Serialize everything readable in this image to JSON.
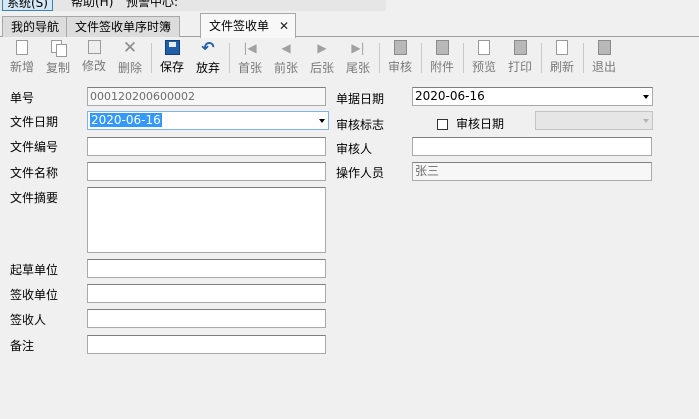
{
  "menu": {
    "system": "系统(S)",
    "help": "帮助(H)",
    "warning_center": "预警中心:"
  },
  "tabs": [
    {
      "label": "我的导航"
    },
    {
      "label": "文件签收单序时簿"
    },
    {
      "label": "文件签收单",
      "close": "✕"
    }
  ],
  "toolbar": {
    "new": "新增",
    "copy": "复制",
    "edit": "修改",
    "delete": "删除",
    "save": "保存",
    "undo": "放弃",
    "first": "首张",
    "prev": "前张",
    "next": "后张",
    "last": "尾张",
    "audit": "审核",
    "attach": "附件",
    "preview": "预览",
    "print": "打印",
    "refresh": "刷新",
    "exit": "退出"
  },
  "form": {
    "doc_no_label": "单号",
    "doc_no_value": "000120200600002",
    "file_date_label": "文件日期",
    "file_date_value": "2020-06-16",
    "file_no_label": "文件编号",
    "file_no_value": "",
    "file_name_label": "文件名称",
    "file_name_value": "",
    "summary_label": "文件摘要",
    "summary_value": "",
    "draft_unit_label": "起草单位",
    "draft_unit_value": "",
    "recv_unit_label": "签收单位",
    "recv_unit_value": "",
    "receiver_label": "签收人",
    "receiver_value": "",
    "remark_label": "备注",
    "remark_value": "",
    "bill_date_label": "单据日期",
    "bill_date_value": "2020-06-16",
    "audit_flag_label": "审核标志",
    "audit_date_label": "审核日期",
    "auditor_label": "审核人",
    "auditor_value": "",
    "operator_label": "操作人员",
    "operator_value": "张三"
  },
  "colors": {
    "accent": "#3399ff",
    "save_icon": "#1f5fa8"
  }
}
